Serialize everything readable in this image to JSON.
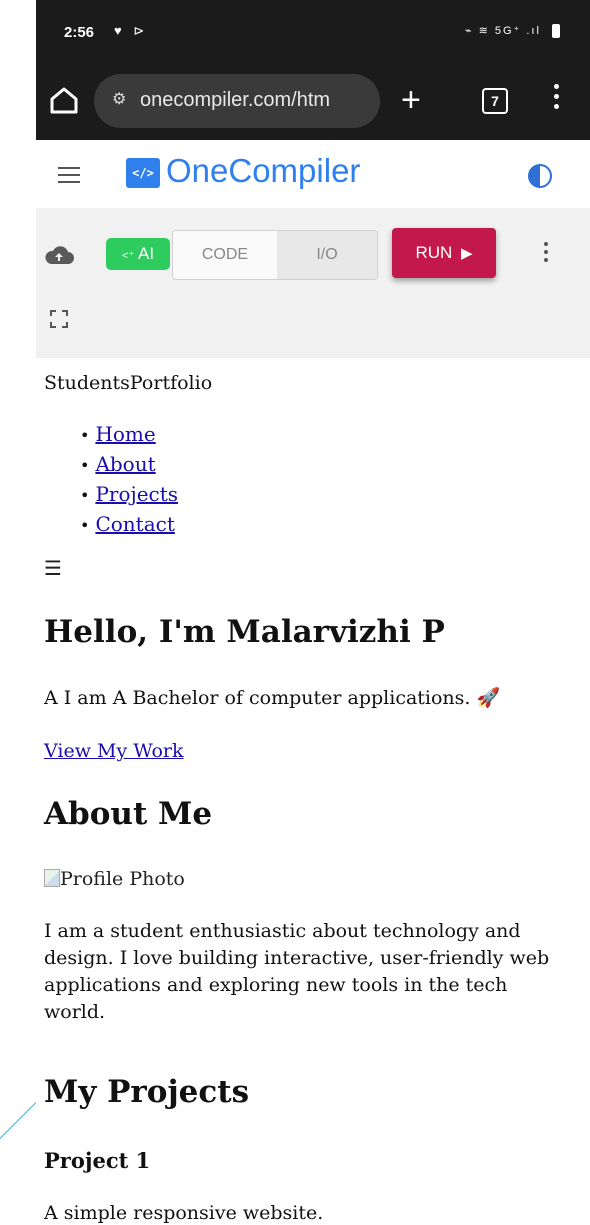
{
  "status_bar": {
    "time": "2:56",
    "left_icons": "♥ ⊳",
    "right_icons": "⌁ ≋ 5G⁺ .ıl"
  },
  "browser": {
    "url": "onecompiler.com/htm",
    "tab_count": "7"
  },
  "app_header": {
    "logo_icon_text": "</>",
    "logo_text": "OneCompiler",
    "accent_color": "#2f80ed"
  },
  "toolbar": {
    "ai_label": "AI",
    "ai_prefix": "<⁺",
    "code_tab": "CODE",
    "io_tab": "I/O",
    "run_label": "RUN",
    "run_color": "#c2184b",
    "ai_color": "#2ecc5f"
  },
  "preview": {
    "brand": "StudentsPortfolio",
    "nav": [
      "Home",
      "About",
      "Projects",
      "Contact"
    ],
    "menu_toggle": "☰",
    "hero_title": "Hello, I'm Malarvizhi P",
    "hero_text": "A I am A Bachelor of computer applications. 🚀",
    "view_link": "View My Work",
    "about_title": "About Me",
    "profile_alt": "Profile Photo",
    "about_text": "I am a student enthusiastic about technology and design. I love building interactive, user-friendly web applications and exploring new tools in the tech world.",
    "projects_title": "My Projects",
    "project1_title": "Project 1",
    "project1_desc": "A simple responsive website."
  }
}
